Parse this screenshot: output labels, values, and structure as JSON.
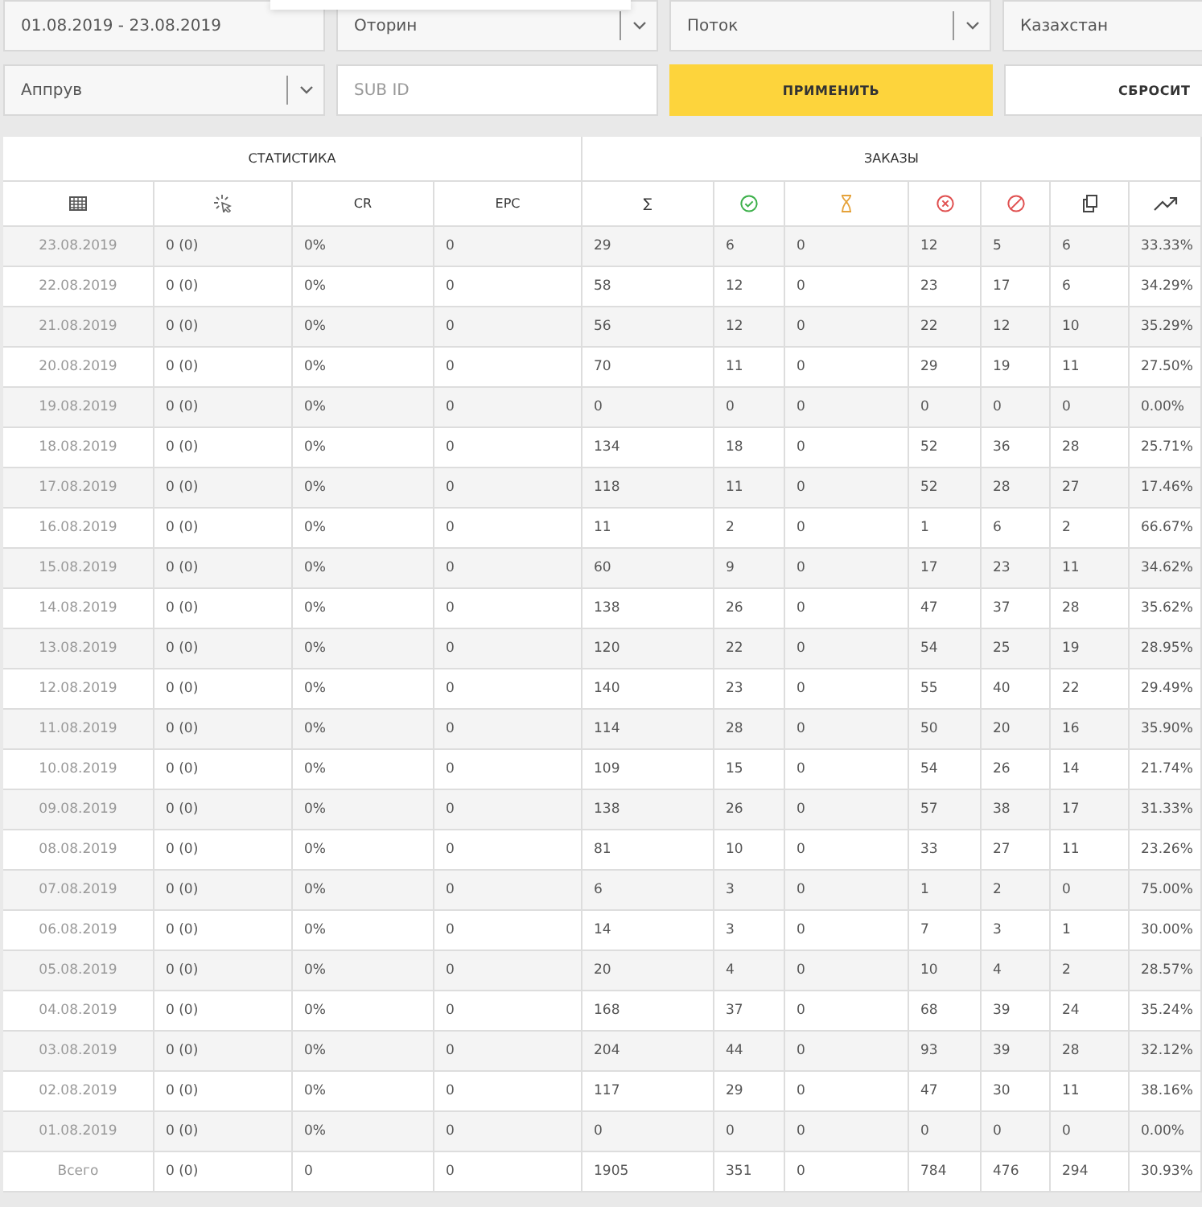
{
  "filters": [
    [
      {
        "kind": "date",
        "value": "01.08.2019 - 23.08.2019"
      },
      {
        "kind": "select",
        "value": "Оторин"
      },
      {
        "kind": "select",
        "value": "Поток"
      },
      {
        "kind": "text",
        "value": "Казахстан"
      }
    ],
    [
      {
        "kind": "select",
        "value": "Аппрув"
      },
      {
        "kind": "input",
        "placeholder": "SUB ID"
      },
      {
        "kind": "primary",
        "label": "ПРИМЕНИТЬ"
      },
      {
        "kind": "secondary",
        "label": "СБРОСИТ"
      }
    ]
  ],
  "table": {
    "groups": [
      {
        "label": "СТАТИСТИКА"
      },
      {
        "label": "ЗАКАЗЫ"
      }
    ],
    "columns": [
      {
        "kind": "icon"
      },
      {
        "kind": "icon"
      },
      {
        "kind": "text",
        "label": "CR"
      },
      {
        "kind": "text",
        "label": "EPC"
      },
      {
        "kind": "text",
        "label": "∑"
      },
      {
        "kind": "icon"
      },
      {
        "kind": "icon"
      },
      {
        "kind": "icon"
      },
      {
        "kind": "icon"
      },
      {
        "kind": "icon"
      },
      {
        "kind": "icon"
      }
    ],
    "rows": [
      [
        "23.08.2019",
        "0 (0)",
        "0%",
        "0",
        "29",
        "6",
        "0",
        "12",
        "5",
        "6",
        "33.33%"
      ],
      [
        "22.08.2019",
        "0 (0)",
        "0%",
        "0",
        "58",
        "12",
        "0",
        "23",
        "17",
        "6",
        "34.29%"
      ],
      [
        "21.08.2019",
        "0 (0)",
        "0%",
        "0",
        "56",
        "12",
        "0",
        "22",
        "12",
        "10",
        "35.29%"
      ],
      [
        "20.08.2019",
        "0 (0)",
        "0%",
        "0",
        "70",
        "11",
        "0",
        "29",
        "19",
        "11",
        "27.50%"
      ],
      [
        "19.08.2019",
        "0 (0)",
        "0%",
        "0",
        "0",
        "0",
        "0",
        "0",
        "0",
        "0",
        "0.00%"
      ],
      [
        "18.08.2019",
        "0 (0)",
        "0%",
        "0",
        "134",
        "18",
        "0",
        "52",
        "36",
        "28",
        "25.71%"
      ],
      [
        "17.08.2019",
        "0 (0)",
        "0%",
        "0",
        "118",
        "11",
        "0",
        "52",
        "28",
        "27",
        "17.46%"
      ],
      [
        "16.08.2019",
        "0 (0)",
        "0%",
        "0",
        "11",
        "2",
        "0",
        "1",
        "6",
        "2",
        "66.67%"
      ],
      [
        "15.08.2019",
        "0 (0)",
        "0%",
        "0",
        "60",
        "9",
        "0",
        "17",
        "23",
        "11",
        "34.62%"
      ],
      [
        "14.08.2019",
        "0 (0)",
        "0%",
        "0",
        "138",
        "26",
        "0",
        "47",
        "37",
        "28",
        "35.62%"
      ],
      [
        "13.08.2019",
        "0 (0)",
        "0%",
        "0",
        "120",
        "22",
        "0",
        "54",
        "25",
        "19",
        "28.95%"
      ],
      [
        "12.08.2019",
        "0 (0)",
        "0%",
        "0",
        "140",
        "23",
        "0",
        "55",
        "40",
        "22",
        "29.49%"
      ],
      [
        "11.08.2019",
        "0 (0)",
        "0%",
        "0",
        "114",
        "28",
        "0",
        "50",
        "20",
        "16",
        "35.90%"
      ],
      [
        "10.08.2019",
        "0 (0)",
        "0%",
        "0",
        "109",
        "15",
        "0",
        "54",
        "26",
        "14",
        "21.74%"
      ],
      [
        "09.08.2019",
        "0 (0)",
        "0%",
        "0",
        "138",
        "26",
        "0",
        "57",
        "38",
        "17",
        "31.33%"
      ],
      [
        "08.08.2019",
        "0 (0)",
        "0%",
        "0",
        "81",
        "10",
        "0",
        "33",
        "27",
        "11",
        "23.26%"
      ],
      [
        "07.08.2019",
        "0 (0)",
        "0%",
        "0",
        "6",
        "3",
        "0",
        "1",
        "2",
        "0",
        "75.00%"
      ],
      [
        "06.08.2019",
        "0 (0)",
        "0%",
        "0",
        "14",
        "3",
        "0",
        "7",
        "3",
        "1",
        "30.00%"
      ],
      [
        "05.08.2019",
        "0 (0)",
        "0%",
        "0",
        "20",
        "4",
        "0",
        "10",
        "4",
        "2",
        "28.57%"
      ],
      [
        "04.08.2019",
        "0 (0)",
        "0%",
        "0",
        "168",
        "37",
        "0",
        "68",
        "39",
        "24",
        "35.24%"
      ],
      [
        "03.08.2019",
        "0 (0)",
        "0%",
        "0",
        "204",
        "44",
        "0",
        "93",
        "39",
        "28",
        "32.12%"
      ],
      [
        "02.08.2019",
        "0 (0)",
        "0%",
        "0",
        "117",
        "29",
        "0",
        "47",
        "30",
        "11",
        "38.16%"
      ],
      [
        "01.08.2019",
        "0 (0)",
        "0%",
        "0",
        "0",
        "0",
        "0",
        "0",
        "0",
        "0",
        "0.00%"
      ]
    ],
    "total": [
      "Всего",
      "0 (0)",
      "0",
      "0",
      "1905",
      "351",
      "0",
      "784",
      "476",
      "294",
      "30.93%"
    ]
  }
}
